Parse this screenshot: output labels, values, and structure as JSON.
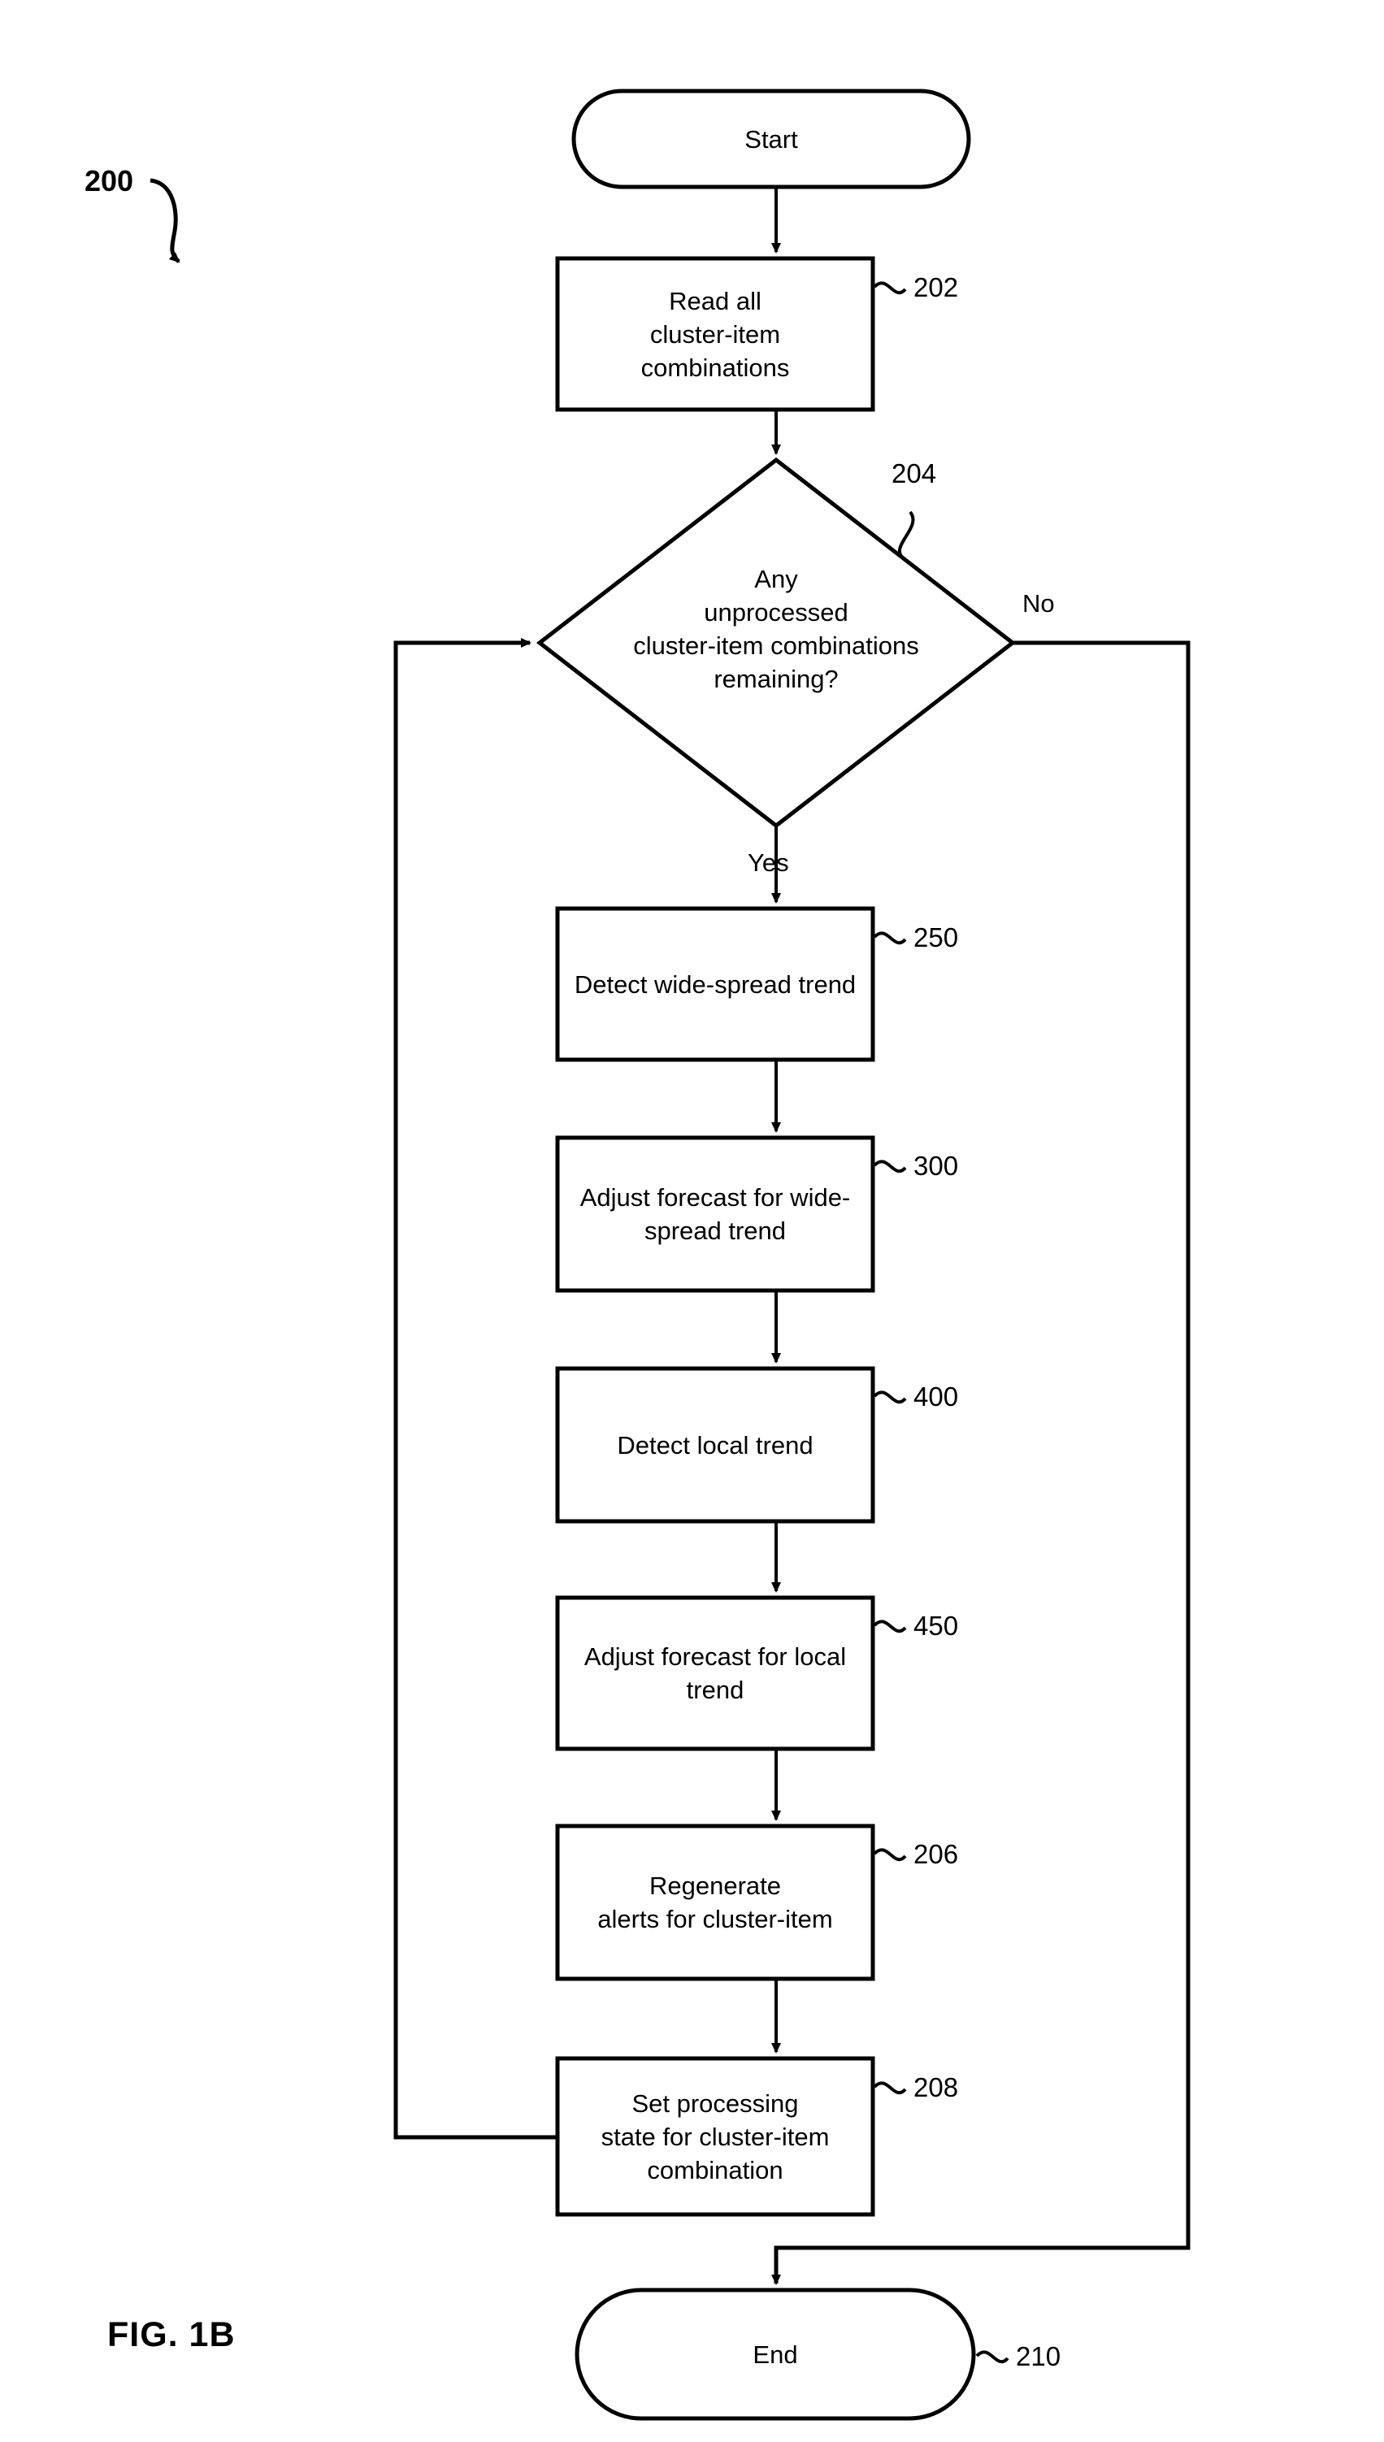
{
  "figure": {
    "label": "FIG. 1B",
    "system_ref": "200"
  },
  "nodes": {
    "start": {
      "id": "start",
      "shape": "terminator",
      "text": "Start",
      "ref": ""
    },
    "read_all": {
      "id": "read-all-cluster-item-combinations",
      "shape": "process",
      "text": "Read all\ncluster-item\ncombinations",
      "ref": "202"
    },
    "decision": {
      "id": "any-unprocessed-decision",
      "shape": "decision",
      "text": "Any\nunprocessed\ncluster-item combinations\nremaining?",
      "ref": "204"
    },
    "detect_wide": {
      "id": "detect-wide-spread-trend",
      "shape": "process",
      "text": "Detect wide-spread trend",
      "ref": "250"
    },
    "adjust_wide": {
      "id": "adjust-forecast-wide-spread-trend",
      "shape": "process",
      "text": "Adjust forecast for wide-\nspread trend",
      "ref": "300"
    },
    "detect_local": {
      "id": "detect-local-trend",
      "shape": "process",
      "text": "Detect local trend",
      "ref": "400"
    },
    "adjust_local": {
      "id": "adjust-forecast-local-trend",
      "shape": "process",
      "text": "Adjust forecast for local trend",
      "ref": "450"
    },
    "regenerate": {
      "id": "regenerate-alerts-for-cluster-item",
      "shape": "process",
      "text": "Regenerate\nalerts for cluster-item",
      "ref": "206"
    },
    "set_state": {
      "id": "set-processing-state",
      "shape": "process",
      "text": "Set processing\nstate for cluster-item\ncombination",
      "ref": "208"
    },
    "end": {
      "id": "end",
      "shape": "terminator",
      "text": "End",
      "ref": "210"
    }
  },
  "edge_labels": {
    "yes": "Yes",
    "no": "No"
  },
  "colors": {
    "stroke": "#000000",
    "fill": "#ffffff",
    "text": "#000000"
  }
}
